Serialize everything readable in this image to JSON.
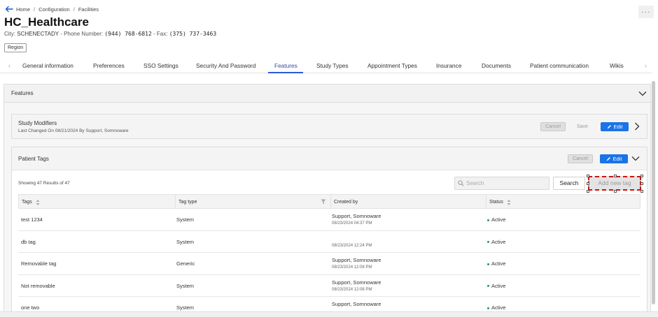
{
  "breadcrumb": {
    "items": [
      "Home",
      "Configuration",
      "Facilities"
    ]
  },
  "header": {
    "title": "HC_Healthcare",
    "city_label": "City:",
    "city": "SCHENECTADY",
    "phone_label": "- Phone Number:",
    "phone": "(944) 768-6812",
    "fax_label": "- Fax:",
    "fax": "(375) 737-3463",
    "region_badge": "Region",
    "more": "···"
  },
  "tabs": [
    "General information",
    "Preferences",
    "SSO Settings",
    "Security And Password",
    "Features",
    "Study Types",
    "Appointment Types",
    "Insurance",
    "Documents",
    "Patient communication",
    "Wikis"
  ],
  "active_tab": "Features",
  "features_panel": {
    "title": "Features"
  },
  "study_modifiers": {
    "title": "Study Modifiers",
    "subtitle": "Last Changed On 08/21/2024 By Support, Somnoware",
    "cancel_label": "Cancel",
    "save_label": "Save",
    "edit_label": "Edit"
  },
  "patient_tags": {
    "title": "Patient Tags",
    "cancel_label": "Cancel",
    "edit_label": "Edit",
    "showing_text": "Showing 47 Results of 47",
    "search_placeholder": "Search",
    "search_button": "Search",
    "add_button": "Add new tag",
    "columns": [
      "Tags",
      "Tag type",
      "Created by",
      "Status"
    ],
    "rows": [
      {
        "tag": "test 1234",
        "type": "System",
        "created_by": "Support, Somnoware",
        "created_at": "08/23/2024 04:37 PM",
        "status": "Active"
      },
      {
        "tag": "db tag",
        "type": "System",
        "created_by": "",
        "created_at": "08/23/2024 12:24 PM",
        "status": "Active"
      },
      {
        "tag": "Removable tag",
        "type": "Generic",
        "created_by": "Support, Somnoware",
        "created_at": "08/23/2024 12:08 PM",
        "status": "Active"
      },
      {
        "tag": "Not removable",
        "type": "System",
        "created_by": "Support, Somnoware",
        "created_at": "08/23/2024 12:08 PM",
        "status": "Active"
      },
      {
        "tag": "one two",
        "type": "System",
        "created_by": "Support, Somnoware",
        "created_at": "",
        "status": "Active"
      }
    ]
  },
  "colors": {
    "accent_blue": "#1a73e8",
    "active_tab_underline": "#2a5bd7",
    "status_active": "#1e9e57",
    "highlight_red": "#cc1111"
  }
}
